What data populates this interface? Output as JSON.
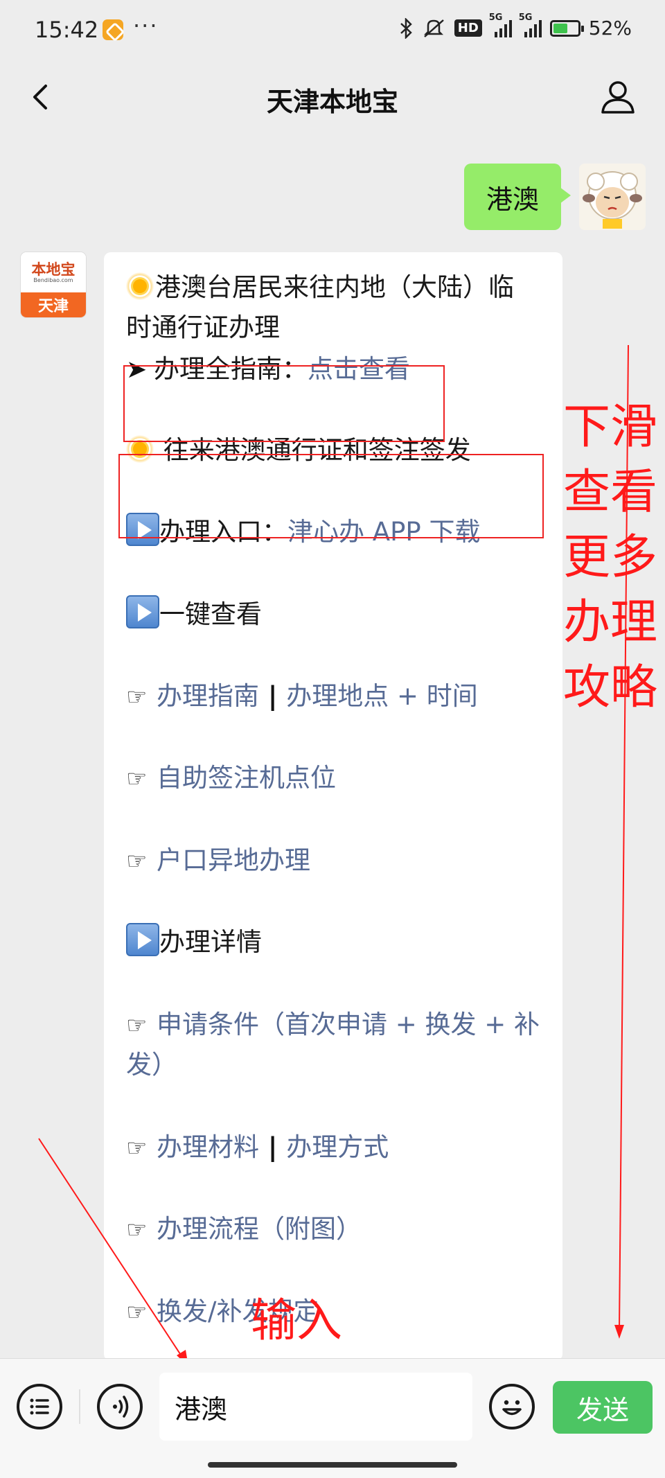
{
  "status_bar": {
    "time": "15:42",
    "dots": "···",
    "battery": "52%",
    "network_a": "5G",
    "network_b": "5G",
    "hd_label": "HD"
  },
  "header": {
    "title": "天津本地宝",
    "back_icon": "chevron-left-icon",
    "user_icon": "person-icon"
  },
  "chat": {
    "user_message": "港澳",
    "bot_message": {
      "title_line1": "港澳台居民来往内地（大陆）临",
      "title_line2": "时通行证办理",
      "guide_label": "办理全指南：",
      "guide_link": "点击查看",
      "permit_heading": "往来港澳通行证和签注签发",
      "entry_label": "办理入口：",
      "entry_link": "津心办 APP 下载",
      "quick_view": "一键查看",
      "link_guide": "办理指南",
      "link_place_time": "办理地点 + 时间",
      "link_self_service": "自助签注机点位",
      "link_remote_hukou": "户口异地办理",
      "details": "办理详情",
      "link_conditions_1": "申请条件（首次申请 + 换发 + 补",
      "link_conditions_2": "发）",
      "link_materials": "办理材料",
      "link_methods": "办理方式",
      "link_process": "办理流程（附图）",
      "link_partial": "换发/补发规定"
    }
  },
  "bot_avatar": {
    "logo_text": "本地宝",
    "logo_sub": "Bendibao.com",
    "city": "天津"
  },
  "annotations": {
    "scroll_hint_lines": [
      "下滑",
      "查看",
      "更多",
      "办理",
      "攻略"
    ],
    "input_hint": "输入",
    "color": "#ff1a1a"
  },
  "input_bar": {
    "value": "港澳",
    "send_label": "发送",
    "menu_icon": "list-menu-icon",
    "voice_icon": "voice-icon",
    "emoji_icon": "emoji-icon",
    "send_color": "#4cc563"
  },
  "colors": {
    "link": "#576b95",
    "user_bubble": "#95ec69",
    "background": "#ededed"
  }
}
